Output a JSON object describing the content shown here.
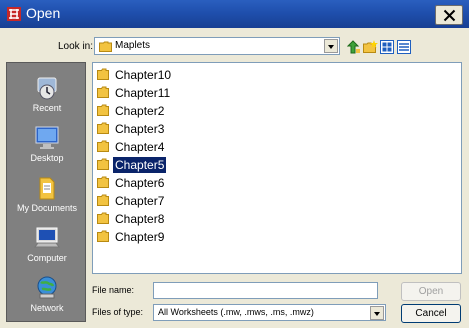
{
  "window": {
    "title": "Open",
    "close_glyph": "X"
  },
  "toolbar": {
    "lookin_label": "Look in:",
    "lookin_value": "Maplets",
    "icons": [
      "up-folder-icon",
      "new-folder-icon",
      "view-menu-icon",
      "details-view-icon"
    ]
  },
  "places": [
    {
      "label": "Recent",
      "icon": "recent-icon"
    },
    {
      "label": "Desktop",
      "icon": "desktop-icon"
    },
    {
      "label": "My Documents",
      "icon": "my-documents-icon"
    },
    {
      "label": "Computer",
      "icon": "computer-icon"
    },
    {
      "label": "Network",
      "icon": "network-icon"
    }
  ],
  "files": [
    {
      "name": "Chapter10"
    },
    {
      "name": "Chapter11"
    },
    {
      "name": "Chapter2"
    },
    {
      "name": "Chapter3"
    },
    {
      "name": "Chapter4"
    },
    {
      "name": "Chapter5",
      "selected": true
    },
    {
      "name": "Chapter6"
    },
    {
      "name": "Chapter7"
    },
    {
      "name": "Chapter8"
    },
    {
      "name": "Chapter9"
    }
  ],
  "form": {
    "filename_label": "File name:",
    "filename_value": "",
    "filetype_label": "Files of type:",
    "filetype_value": "All Worksheets (.mw, .mws, .ms, .mwz)"
  },
  "buttons": {
    "open": "Open",
    "cancel": "Cancel"
  },
  "colors": {
    "title_bar": "#1f4fad",
    "selection": "#0a246a",
    "places_bg": "#808080",
    "dialog_bg": "#ECE9D8"
  }
}
